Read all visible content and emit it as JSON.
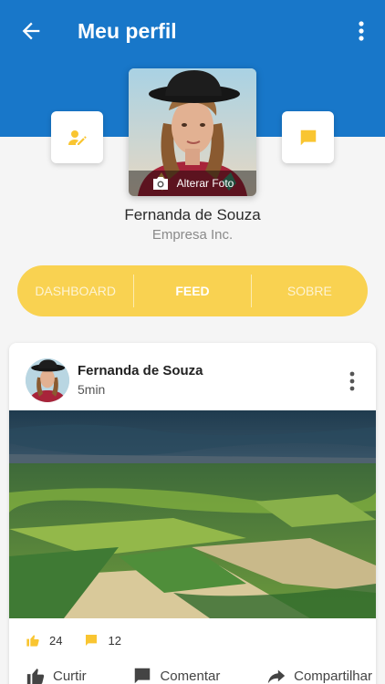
{
  "header": {
    "title": "Meu perfil",
    "back_icon": "arrow-left-icon",
    "menu_icon": "more-vertical-icon",
    "background_color": "#1877c9"
  },
  "profile": {
    "edit_icon": "edit-profile-icon",
    "message_icon": "message-icon",
    "change_photo_label": "Alterar Foto",
    "camera_icon": "camera-icon",
    "name": "Fernanda de Souza",
    "company": "Empresa Inc."
  },
  "tabs": {
    "items": [
      {
        "label": "DASHBOARD",
        "active": false
      },
      {
        "label": "FEED",
        "active": true
      },
      {
        "label": "SOBRE",
        "active": false
      }
    ],
    "background_color": "#f9d251"
  },
  "post": {
    "author": "Fernanda de Souza",
    "time": "5min",
    "likes": "24",
    "comments": "12",
    "actions": {
      "like": "Curtir",
      "comment": "Comentar",
      "share": "Compartilhar"
    }
  },
  "accent_color": "#f9c531"
}
